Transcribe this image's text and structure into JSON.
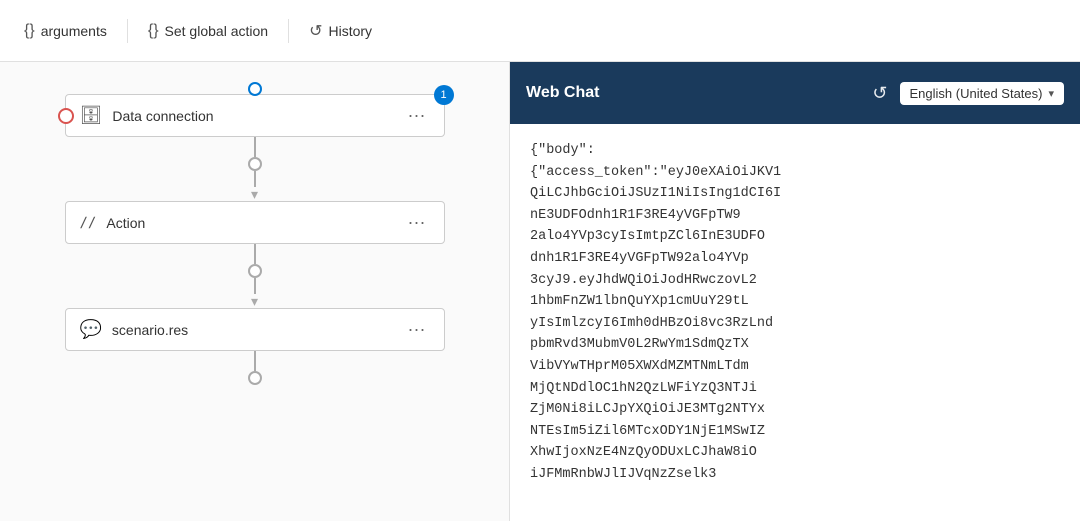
{
  "toolbar": {
    "arguments_label": "arguments",
    "set_global_action_label": "Set global action",
    "history_label": "History"
  },
  "flow": {
    "nodes": [
      {
        "id": "data-connection",
        "label": "Data connection",
        "icon": "🗄",
        "badge": "1"
      },
      {
        "id": "action",
        "label": "Action",
        "icon": "⟨/⟩"
      },
      {
        "id": "scenario-res",
        "label": "scenario.res",
        "icon": "💬"
      }
    ]
  },
  "webchat": {
    "title": "Web Chat",
    "language": "English (United States)",
    "refresh_icon": "↺",
    "message": "{\"body\":\n{\"access_token\":\"eyJ0eXAiOiJKV1\nQiLCJhbGciOiJSUzI1NiIsIng1dCI6I\nnE3UDFOdnh1R1F3RE4yVGFpTW9\n2alo4YVp3cyIsImtpZCl6InE3UDFO\ndnh1R1F3RE4yVGFpTW92alo4YVp\n3cyJ9.eyJhdWQiOiJodHRwczovL2\n1hbmFnZW1lbnQuYXp1cmUuY29tLyIsI\nmlzcyI6Imh0dHBzOi8vc3RzLndpbm\nRvd3MubmV0L2RwYm1SdmQzTXVibVYwTHprM05XWXdMZMT\nNmLTdmMjQtNDdlOC1hN2QzLWFi\nYzQ3NTJiZjM0Ni8iLCJpYXQiOiJE3M\nTg2NTYxNTEsIm5iZil6MTcxODY1Nj\nE1MSwIZXhwIjoxNzE4NzQyODUxL\nCJhaW8iOiJFMmRnbWJlIJVqNzZselk3"
  }
}
